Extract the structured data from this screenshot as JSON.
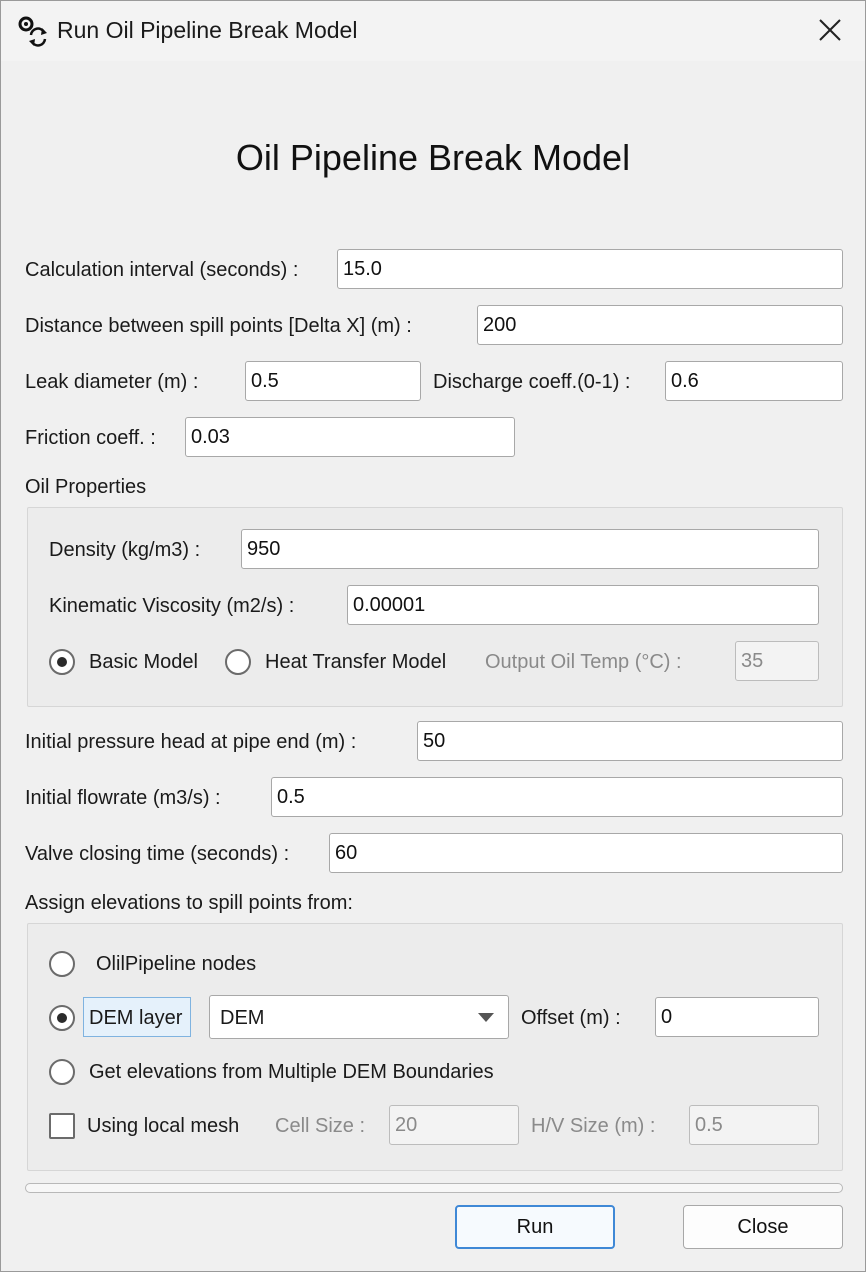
{
  "window": {
    "title": "Run Oil Pipeline Break Model",
    "heading": "Oil Pipeline Break Model"
  },
  "params": {
    "calc_interval": {
      "label": "Calculation interval (seconds) :",
      "value": "15.0"
    },
    "delta_x": {
      "label": "Distance between spill points [Delta X] (m) :",
      "value": "200"
    },
    "leak_diameter": {
      "label": "Leak diameter  (m) :",
      "value": "0.5"
    },
    "discharge_coeff": {
      "label": "Discharge coeff.(0-1) :",
      "value": "0.6"
    },
    "friction_coeff": {
      "label": "Friction coeff. :",
      "value": "0.03"
    }
  },
  "oil_properties": {
    "title": "Oil Properties",
    "density": {
      "label": "Density (kg/m3) :",
      "value": "950"
    },
    "viscosity": {
      "label": "Kinematic  Viscosity (m2/s) :",
      "value": "0.00001"
    },
    "basic_model": {
      "label": "Basic Model",
      "selected": true
    },
    "heat_transfer_model": {
      "label": "Heat Transfer Model",
      "selected": false
    },
    "output_oil_temp": {
      "label": "Output Oil Temp  (°C) :",
      "value": "35"
    }
  },
  "flow": {
    "pressure_head": {
      "label": "Initial pressure head at pipe end (m) :",
      "value": "50"
    },
    "flowrate": {
      "label": "Initial flowrate (m3/s) :",
      "value": "0.5"
    },
    "valve_closing": {
      "label": "Valve closing time (seconds) :",
      "value": "60"
    }
  },
  "elevations": {
    "title": "Assign elevations to spill points from:",
    "pipeline_nodes": {
      "label": "OlilPipeline nodes",
      "selected": false
    },
    "dem_layer": {
      "label": "DEM layer",
      "selected": true,
      "layer": "DEM"
    },
    "offset": {
      "label": "Offset (m) :",
      "value": "0"
    },
    "multiple_dem": {
      "label": "Get elevations from Multiple DEM Boundaries",
      "selected": false
    },
    "local_mesh": {
      "label": "Using local mesh",
      "checked": false
    },
    "cell_size": {
      "label": "Cell Size :",
      "value": "20"
    },
    "hv_size": {
      "label": "H/V Size (m) :",
      "value": "0.5"
    }
  },
  "progress": {
    "value": 0
  },
  "buttons": {
    "run": "Run",
    "close": "Close"
  }
}
